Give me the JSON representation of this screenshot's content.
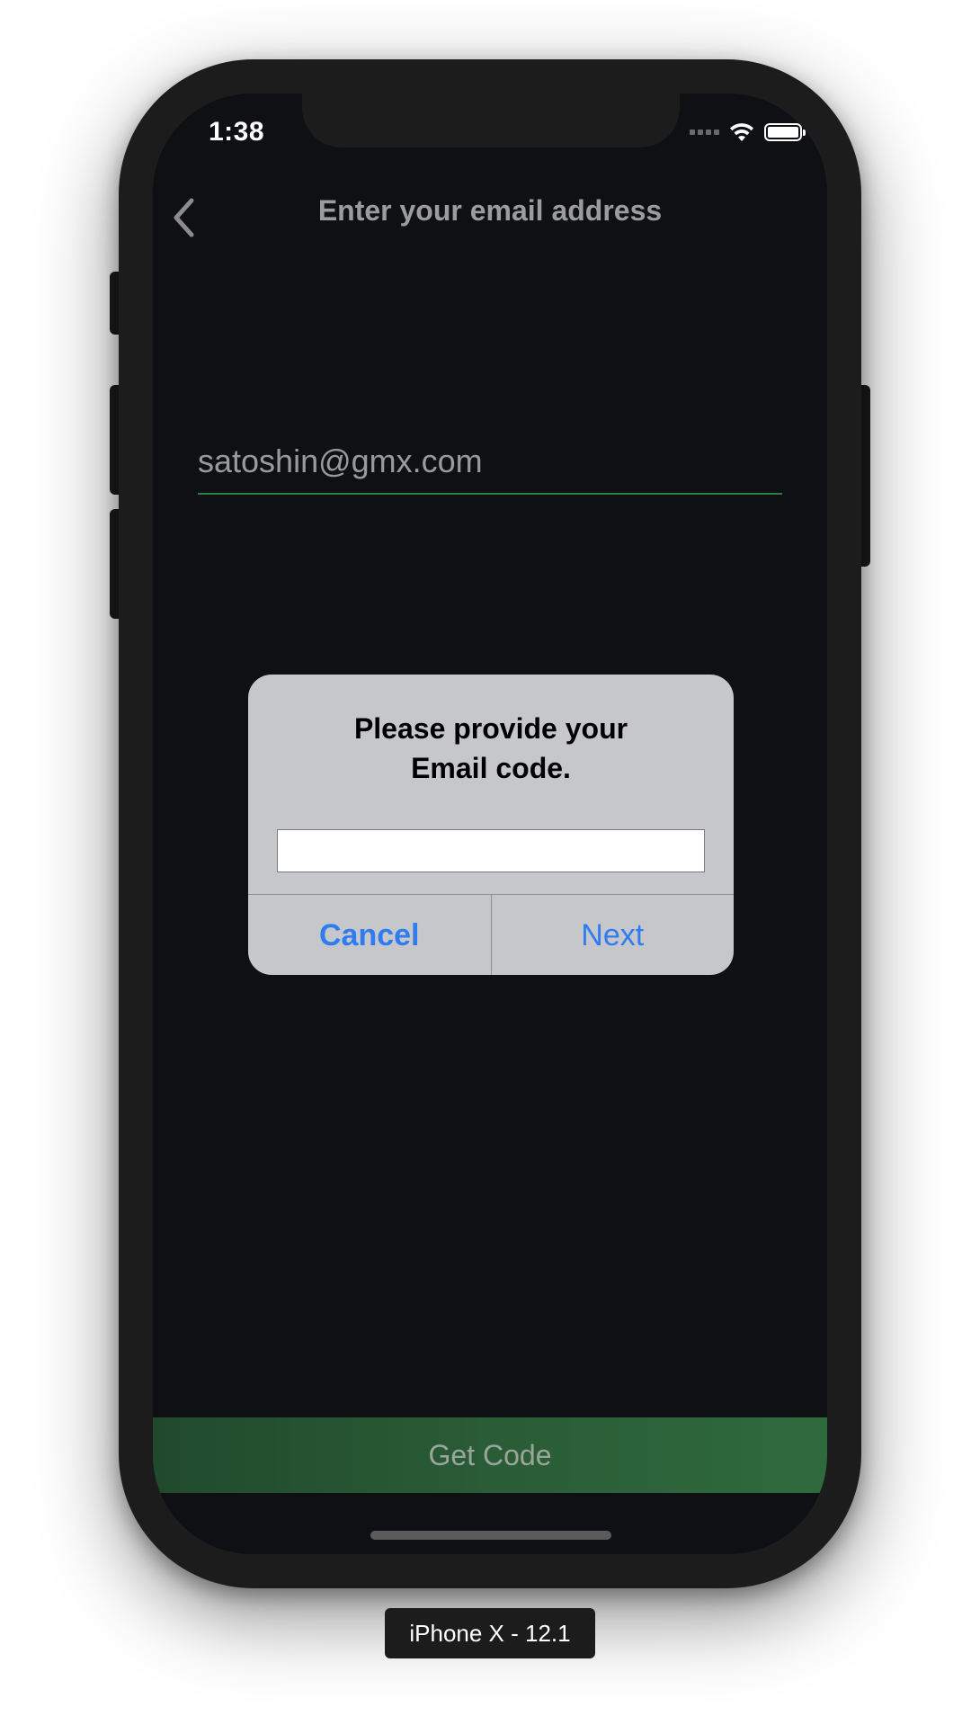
{
  "status_bar": {
    "time": "1:38",
    "wifi_icon": "wifi-icon",
    "battery_icon": "battery-icon"
  },
  "nav": {
    "back_icon": "chevron-left-icon",
    "title": "Enter your email address"
  },
  "email_field": {
    "value": "satoshin@gmx.com",
    "underline_color": "#2e7d4a"
  },
  "alert": {
    "title_line1": "Please provide your",
    "title_line2": "Email code.",
    "input_value": "",
    "cancel_label": "Cancel",
    "next_label": "Next",
    "button_color": "#2f7cf0"
  },
  "primary_button": {
    "label": "Get Code",
    "color": "#2a5c36"
  },
  "device_label": "iPhone X - 12.1"
}
